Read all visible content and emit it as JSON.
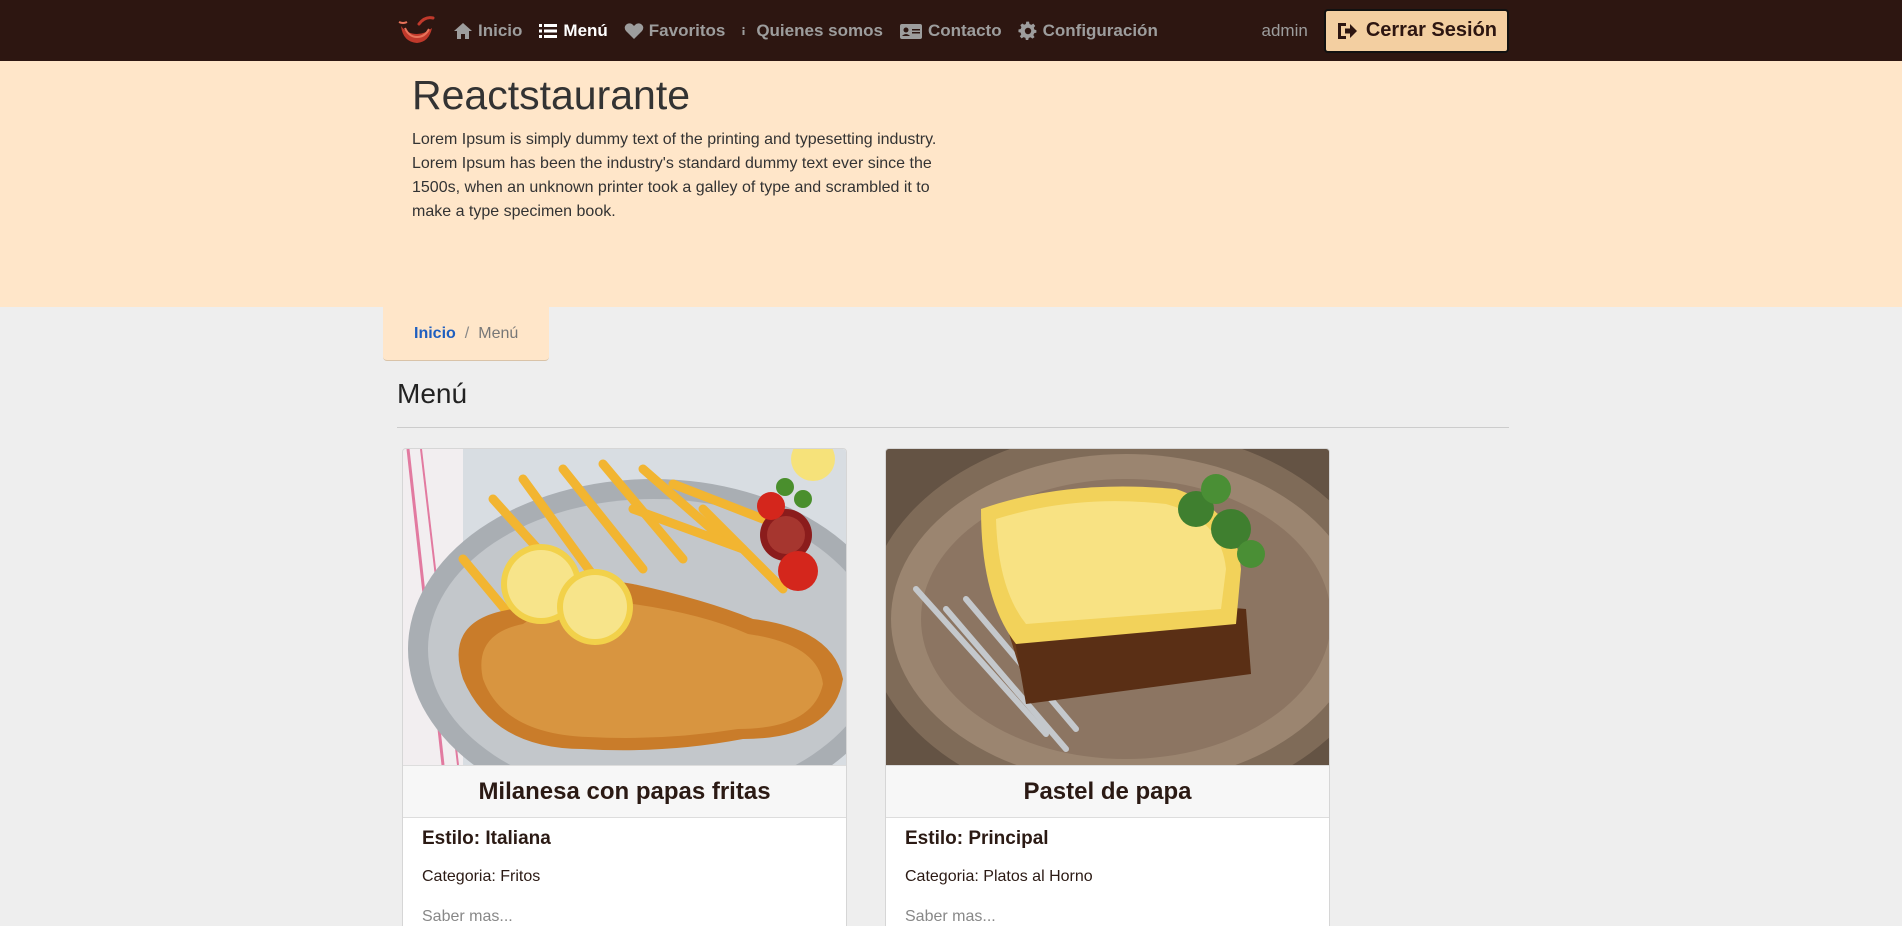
{
  "nav": {
    "brand_icon": "chili-pepper-logo",
    "items": [
      {
        "label": "Inicio",
        "icon": "home-icon",
        "active": false
      },
      {
        "label": "Menú",
        "icon": "list-icon",
        "active": true
      },
      {
        "label": "Favoritos",
        "icon": "heart-icon",
        "active": false
      },
      {
        "label": "Quienes somos",
        "icon": "info-icon",
        "active": false
      },
      {
        "label": "Contacto",
        "icon": "contact-card-icon",
        "active": false
      },
      {
        "label": "Configuración",
        "icon": "gear-icon",
        "active": false
      }
    ],
    "user": "admin",
    "logout_label": "Cerrar Sesión"
  },
  "jumbotron": {
    "title": "Reactstaurante",
    "text": "Lorem Ipsum is simply dummy text of the printing and typesetting industry. Lorem Ipsum has been the industry's standard dummy text ever since the 1500s, when an unknown printer took a galley of type and scrambled it to make a type specimen book."
  },
  "breadcrumb": {
    "home": "Inicio",
    "separator": "/",
    "current": "Menú"
  },
  "section": {
    "title": "Menú"
  },
  "cards": [
    {
      "title": "Milanesa con papas fritas",
      "style": "Estilo: Italiana",
      "category": "Categoria: Fritos",
      "more": "Saber mas..."
    },
    {
      "title": "Pastel de papa",
      "style": "Estilo: Principal",
      "category": "Categoria: Platos al Horno",
      "more": "Saber mas..."
    }
  ],
  "colors": {
    "navbar": "#2d1611",
    "jumbotron": "#ffe6c9",
    "accent_button": "#f3cfa1",
    "link": "#1f5fbf"
  }
}
